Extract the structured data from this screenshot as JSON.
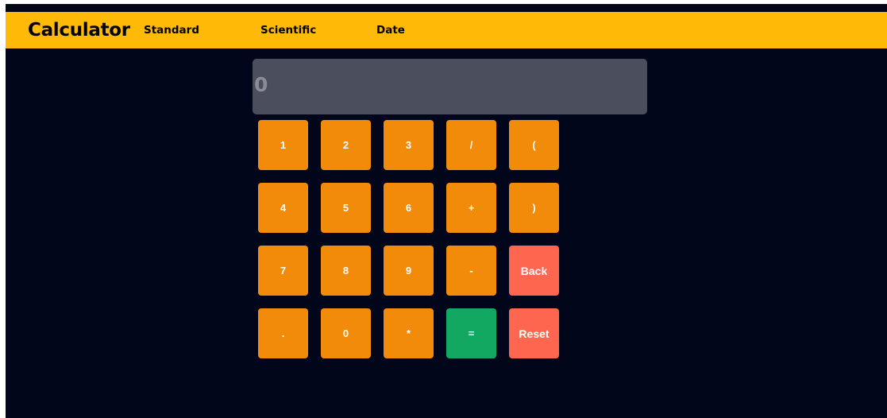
{
  "app": {
    "title": "Calculator"
  },
  "nav": {
    "items": [
      {
        "label": "Standard"
      },
      {
        "label": "Scientific"
      },
      {
        "label": "Date"
      }
    ]
  },
  "display": {
    "value": "0"
  },
  "keypad": {
    "keys": [
      {
        "label": "1",
        "name": "key-1"
      },
      {
        "label": "2",
        "name": "key-2"
      },
      {
        "label": "3",
        "name": "key-3"
      },
      {
        "label": "/",
        "name": "key-divide"
      },
      {
        "label": "(",
        "name": "key-open-paren"
      },
      {
        "label": "4",
        "name": "key-4"
      },
      {
        "label": "5",
        "name": "key-5"
      },
      {
        "label": "6",
        "name": "key-6"
      },
      {
        "label": "+",
        "name": "key-plus"
      },
      {
        "label": ")",
        "name": "key-close-paren"
      },
      {
        "label": "7",
        "name": "key-7"
      },
      {
        "label": "8",
        "name": "key-8"
      },
      {
        "label": "9",
        "name": "key-9"
      },
      {
        "label": "-",
        "name": "key-minus"
      },
      {
        "label": "Back",
        "name": "back-button"
      },
      {
        "label": ".",
        "name": "key-decimal"
      },
      {
        "label": "0",
        "name": "key-0"
      },
      {
        "label": "*",
        "name": "key-multiply"
      },
      {
        "label": "=",
        "name": "equals-button"
      },
      {
        "label": "Reset",
        "name": "reset-button"
      }
    ]
  },
  "colors": {
    "navbar": "#ffba08",
    "background": "#01061a",
    "display": "#4b4e5d",
    "key": "#f28b0a",
    "key_action": "#fe6650",
    "key_equals": "#12a862"
  }
}
